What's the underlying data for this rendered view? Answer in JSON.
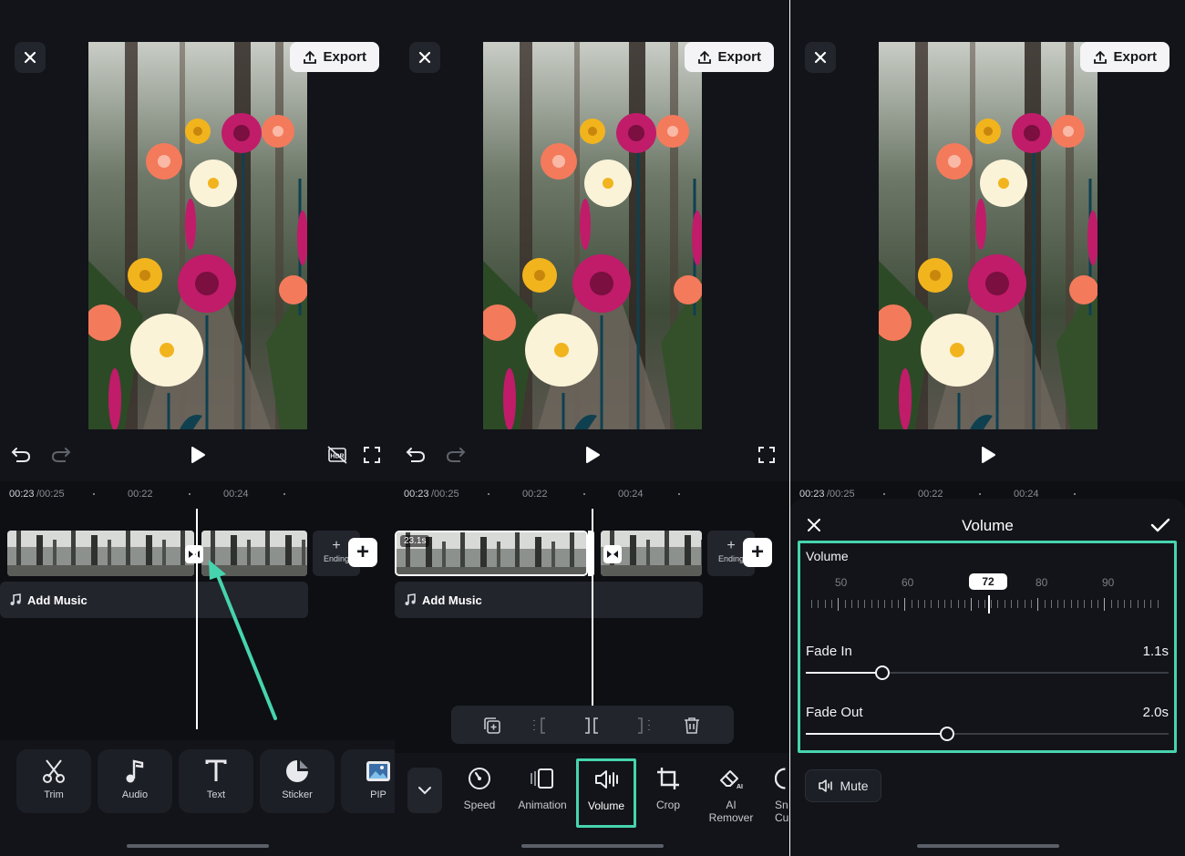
{
  "export_label": "Export",
  "time_current": "00:23",
  "time_total": "/00:25",
  "tick_22": "00:22",
  "tick_24": "00:24",
  "add_music": "Add Music",
  "ending": "Ending",
  "clip_duration": "23.1s",
  "panel1_tools": [
    {
      "label": "Trim",
      "icon": "scissors-icon"
    },
    {
      "label": "Audio",
      "icon": "music-note-icon"
    },
    {
      "label": "Text",
      "icon": "text-icon"
    },
    {
      "label": "Sticker",
      "icon": "sticker-icon"
    },
    {
      "label": "PIP",
      "icon": "image-icon"
    }
  ],
  "panel2_tools": [
    {
      "label": "Speed",
      "icon": "speed-icon"
    },
    {
      "label": "Animation",
      "icon": "animation-icon"
    },
    {
      "label": "Volume",
      "icon": "volume-icon"
    },
    {
      "label": "Crop",
      "icon": "crop-icon"
    },
    {
      "label": "AI\nRemover",
      "label_line1": "AI",
      "label_line2": "Remover",
      "icon": "eraser-icon"
    },
    {
      "label_line1": "Sn",
      "label_line2": "Cu",
      "icon": "cut-icon"
    }
  ],
  "volume_panel": {
    "title": "Volume",
    "volume_label": "Volume",
    "ruler": [
      "50",
      "60",
      "72",
      "80",
      "90"
    ],
    "volume_value": 72,
    "fade_in_label": "Fade In",
    "fade_in_value": "1.1s",
    "fade_in_fraction": 0.21,
    "fade_out_label": "Fade Out",
    "fade_out_value": "2.0s",
    "fade_out_fraction": 0.39,
    "mute_label": "Mute"
  },
  "colors": {
    "highlight": "#46d4ae",
    "background": "#121419"
  }
}
